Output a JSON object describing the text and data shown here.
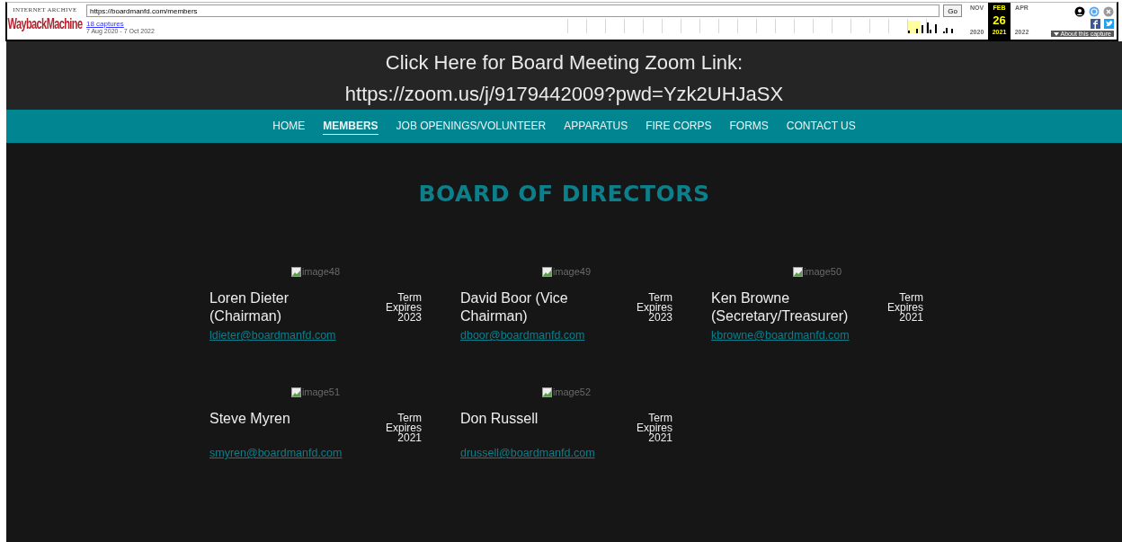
{
  "wayback": {
    "tagline": "INTERNET ARCHIVE",
    "logo": "WaybackMachine",
    "url": "https://boardmanfd.com/members",
    "go": "Go",
    "captures": "18 captures",
    "range": "7 Aug 2020 - 7 Oct 2022",
    "months": [
      {
        "month": "NOV",
        "year": "2020",
        "selected": false
      },
      {
        "month": "FEB",
        "day": "26",
        "year": "2021",
        "selected": true
      },
      {
        "month": "APR",
        "year": "2022",
        "selected": false
      }
    ],
    "about": "About this capture"
  },
  "banner": {
    "lines": [
      "Click Here for Board Meeting Zoom Link:",
      "https://zoom.us/j/9179442009?pwd=Yzk2UHJaSX"
    ]
  },
  "nav": [
    {
      "label": "HOME",
      "selected": false
    },
    {
      "label": "MEMBERS",
      "selected": true
    },
    {
      "label": "JOB OPENINGS/VOLUNTEER",
      "selected": false
    },
    {
      "label": "APPARATUS",
      "selected": false
    },
    {
      "label": "FIRE CORPS",
      "selected": false
    },
    {
      "label": "FORMS",
      "selected": false
    },
    {
      "label": "CONTACT US",
      "selected": false
    }
  ],
  "heading": "BOARD OF DIRECTORS",
  "members": [
    {
      "image_alt": "image48",
      "name": "Loren Dieter (Chairman)",
      "term": [
        "Term",
        "Expires",
        "2023"
      ],
      "email": "ldieter@boardmanfd.com"
    },
    {
      "image_alt": "image49",
      "name": "David Boor (Vice Chairman)",
      "term": [
        "Term",
        "Expires",
        "2023"
      ],
      "email": "dboor@boardmanfd.com"
    },
    {
      "image_alt": "image50",
      "name": "Ken Browne (Secretary/Treasurer)",
      "term": [
        "Term",
        "Expires",
        "2021"
      ],
      "email": "kbrowne@boardmanfd.com"
    },
    {
      "image_alt": "image51",
      "name": "Steve Myren",
      "term": [
        "Term",
        "Expires",
        "2021"
      ],
      "email": "smyren@boardmanfd.com"
    },
    {
      "image_alt": "image52",
      "name": "Don Russell",
      "term": [
        "Term",
        "Expires",
        "2021"
      ],
      "email": "drussell@boardmanfd.com"
    }
  ]
}
